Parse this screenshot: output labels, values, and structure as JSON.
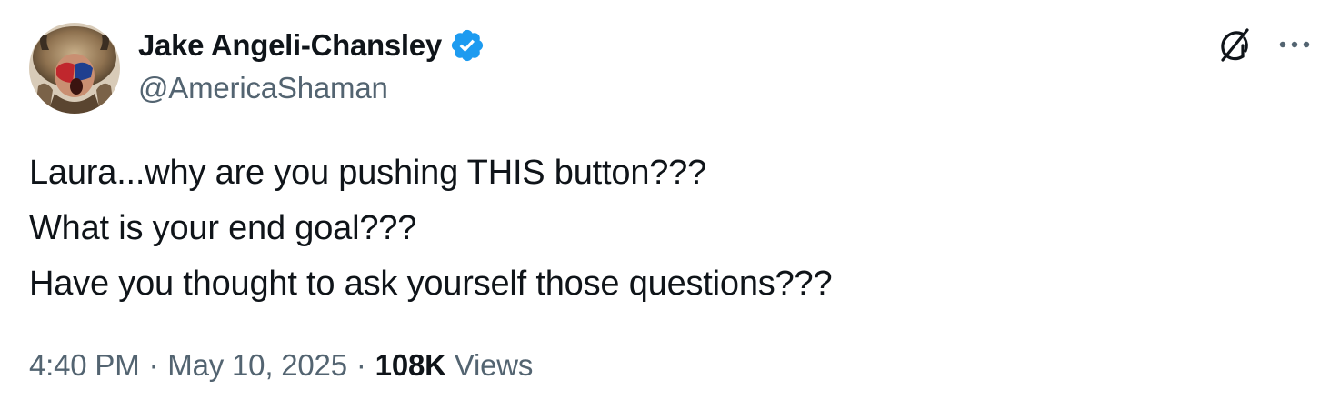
{
  "author": {
    "display_name": "Jake Angeli-Chansley",
    "handle": "@AmericaShaman",
    "verified": true,
    "verified_color": "#1d9bf0"
  },
  "tweet": {
    "lines": [
      "Laura...why are you pushing THIS button???",
      "What is your end goal???",
      "Have you thought to ask yourself those questions???"
    ]
  },
  "meta": {
    "time": "4:40 PM",
    "separator": "·",
    "date": "May 10, 2025",
    "views_count": "108K",
    "views_label": "Views"
  },
  "icons": {
    "grok": "grok-icon",
    "more": "more-icon",
    "verified": "verified-badge-icon"
  },
  "colors": {
    "text_primary": "#0f1419",
    "text_secondary": "#536471",
    "accent": "#1d9bf0"
  }
}
